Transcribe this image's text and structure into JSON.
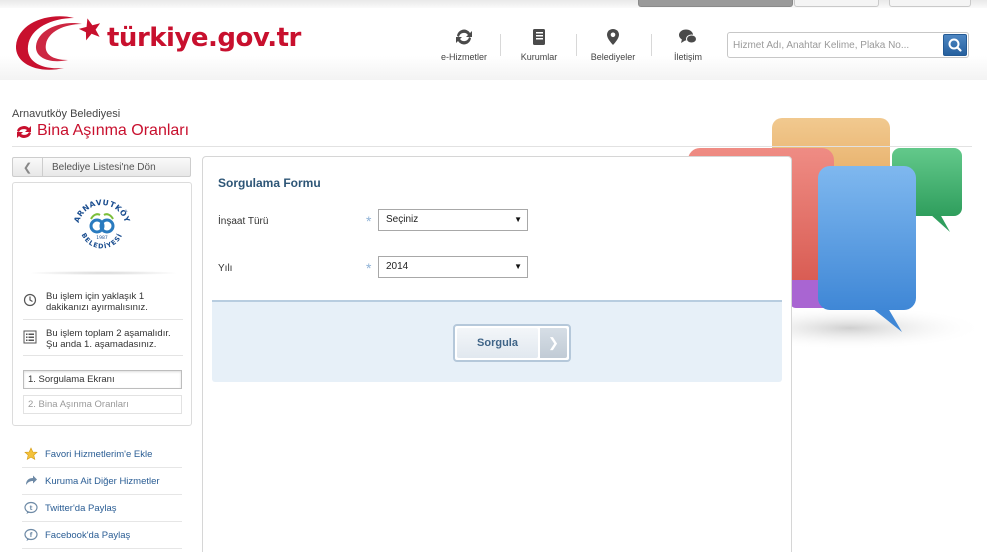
{
  "header": {
    "logo_text": "türkiye.gov.tr",
    "nav": [
      {
        "label": "e-Hizmetler",
        "icon": "refresh-icon"
      },
      {
        "label": "Kurumlar",
        "icon": "book-icon"
      },
      {
        "label": "Belediyeler",
        "icon": "map-pin-icon"
      },
      {
        "label": "İletişim",
        "icon": "chat-bubbles-icon"
      }
    ],
    "search_placeholder": "Hizmet Adı, Anahtar Kelime, Plaka No..."
  },
  "page": {
    "municipality": "Arnavutköy Belediyesi",
    "title": "Bina Aşınma Oranları"
  },
  "sidebar": {
    "back_label": "Belediye Listesi'ne Dön",
    "emblem": {
      "top_text": "ARNAVUTKÖY",
      "bottom_text": "BELEDİYESİ",
      "year": "1987"
    },
    "time_info": "Bu işlem için yaklaşık 1 dakikanızı ayırmalısınız.",
    "steps_info": "Bu işlem toplam 2 aşamalıdır. Şu anda 1. aşamadasınız.",
    "steps": [
      "1. Sorgulama Ekranı",
      "2. Bina Aşınma Oranları"
    ],
    "links": [
      {
        "label": "Favori Hizmetlerim'e Ekle",
        "icon": "star-icon"
      },
      {
        "label": "Kuruma Ait Diğer Hizmetler",
        "icon": "curved-arrow-icon"
      },
      {
        "label": "Twitter'da Paylaş",
        "icon": "twitter-icon"
      },
      {
        "label": "Facebook'da Paylaş",
        "icon": "facebook-icon"
      }
    ]
  },
  "form": {
    "title": "Sorgulama Formu",
    "fields": [
      {
        "label": "İnşaat Türü",
        "value": "Seçiniz"
      },
      {
        "label": "Yılı",
        "value": "2014"
      }
    ],
    "submit_label": "Sorgula"
  },
  "colors": {
    "brand_red": "#c8102e",
    "link_blue": "#2a5d94",
    "form_title": "#2d5576"
  }
}
